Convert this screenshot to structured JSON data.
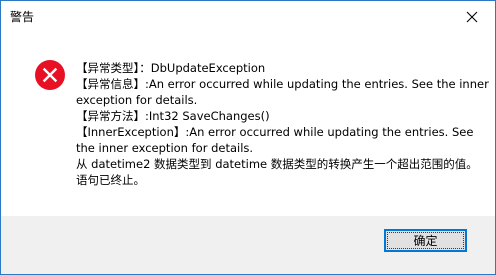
{
  "window": {
    "title": "警告"
  },
  "icons": {
    "status": "error-icon",
    "close": "close-icon"
  },
  "message": {
    "lines": [
      "【异常类型】：DbUpdateException",
      "【异常信息】:An error occurred while updating the entries. See the inner",
      "exception for details.",
      "【异常方法】:Int32 SaveChanges()",
      "【InnerException】:An error occurred while updating the entries. See",
      "the inner exception for details.",
      "从 datetime2 数据类型到 datetime 数据类型的转换产生一个超出范围的值。",
      "语句已终止。"
    ]
  },
  "buttons": {
    "ok_label": "确定"
  },
  "colors": {
    "accent": "#0078d7",
    "error_red": "#e81123",
    "window_border": "#2b78c5"
  }
}
